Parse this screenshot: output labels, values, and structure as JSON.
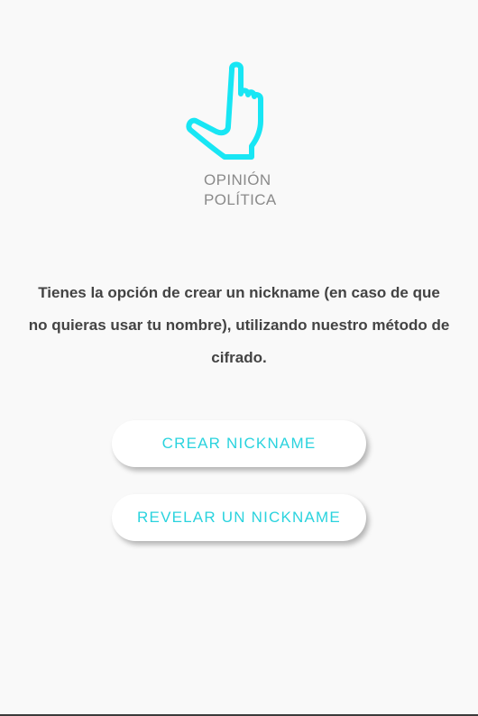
{
  "logo": {
    "icon": "pointing-hand-icon",
    "line1": "OPINIÓN",
    "line2": "POLÍTICA"
  },
  "intro": {
    "text": "Tienes la opción de crear un nickname (en caso de que no quieras usar tu nombre), utilizando nuestro método de cifrado."
  },
  "actions": {
    "create_label": "CREAR NICKNAME",
    "reveal_label": "REVELAR UN NICKNAME"
  },
  "colors": {
    "accent": "#2ad3de",
    "background": "#f9f9f9",
    "text": "#434343"
  }
}
